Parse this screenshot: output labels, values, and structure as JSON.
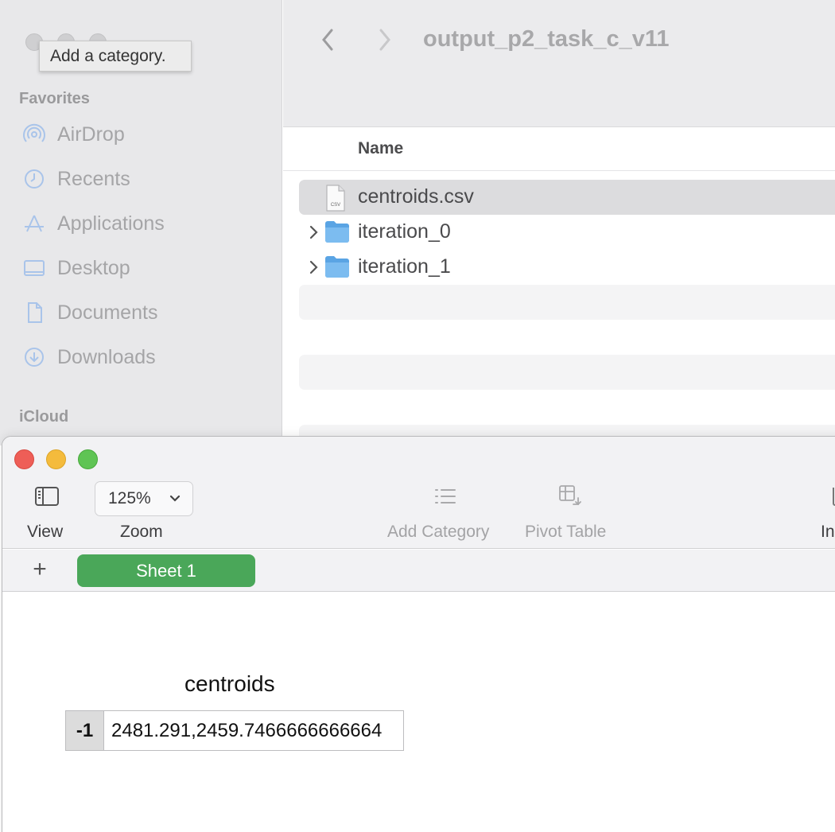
{
  "finder": {
    "tooltip": "Add a category.",
    "sidebar": {
      "favorites_heading": "Favorites",
      "items": [
        {
          "label": "AirDrop",
          "icon": "airdrop-icon"
        },
        {
          "label": "Recents",
          "icon": "clock-icon"
        },
        {
          "label": "Applications",
          "icon": "applications-icon"
        },
        {
          "label": "Desktop",
          "icon": "desktop-icon"
        },
        {
          "label": "Documents",
          "icon": "document-icon"
        },
        {
          "label": "Downloads",
          "icon": "download-icon"
        }
      ],
      "icloud_heading": "iCloud"
    },
    "title": "output_p2_task_c_v11",
    "column_header": "Name",
    "files": [
      {
        "name": "centroids.csv",
        "icon": "csv-file-icon",
        "selected": true
      },
      {
        "name": "iteration_0",
        "icon": "folder-icon",
        "expandable": true
      },
      {
        "name": "iteration_1",
        "icon": "folder-icon",
        "expandable": true
      }
    ],
    "file_icon_text": "CSV"
  },
  "numbers": {
    "toolbar": {
      "view_label": "View",
      "zoom_value": "125%",
      "zoom_label": "Zoom",
      "add_category_label": "Add Category",
      "pivot_table_label": "Pivot Table",
      "insert_label": "In"
    },
    "add_sheet": "+",
    "sheet_tab": "Sheet 1",
    "table": {
      "title": "centroids",
      "row_header": "-1",
      "cell_value": "2481.291,2459.7466666666664"
    }
  },
  "colors": {
    "sheet_tab": "#4aa759",
    "close": "#ee5e57",
    "minimize": "#f4bb3c",
    "zoom": "#5fc454",
    "sidebar_icon": "#a9c4ea",
    "folder": "#6fb2ea"
  }
}
